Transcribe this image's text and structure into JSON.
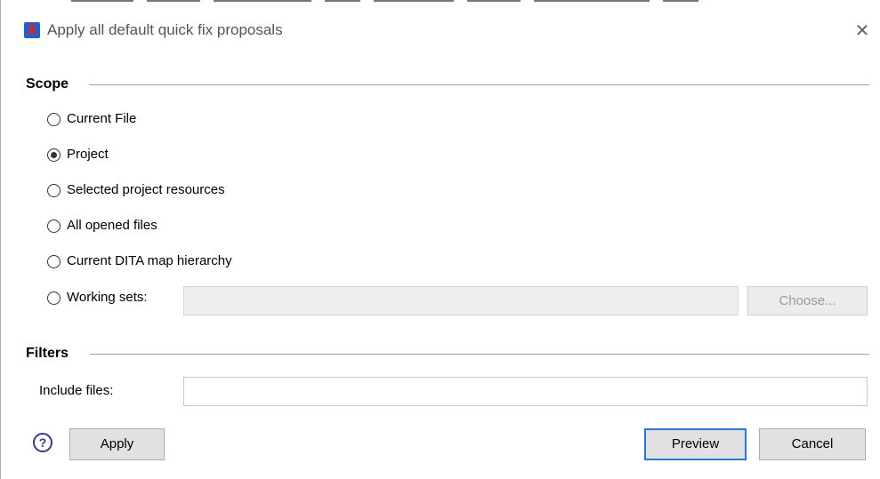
{
  "dialog": {
    "title": "Apply all default quick fix proposals",
    "icons": {
      "app": "oxygen-app-icon",
      "close": "close-icon",
      "help": "help-icon"
    },
    "app_icon_glyph": "X",
    "close_glyph": "✕",
    "help_glyph": "?"
  },
  "scope": {
    "title": "Scope",
    "options": [
      {
        "label": "Current File",
        "selected": false
      },
      {
        "label": "Project",
        "selected": true
      },
      {
        "label": "Selected project resources",
        "selected": false
      },
      {
        "label": "All opened files",
        "selected": false
      },
      {
        "label": "Current DITA map hierarchy",
        "selected": false
      },
      {
        "label": "Working sets:",
        "selected": false
      }
    ],
    "working_sets_value": "",
    "choose_label": "Choose..."
  },
  "filters": {
    "title": "Filters",
    "include_label": "Include files:",
    "include_value": ""
  },
  "buttons": {
    "apply": "Apply",
    "preview": "Preview",
    "cancel": "Cancel"
  },
  "colors": {
    "accent": "#2a78d6",
    "disabled_text": "#9a9a9a"
  }
}
